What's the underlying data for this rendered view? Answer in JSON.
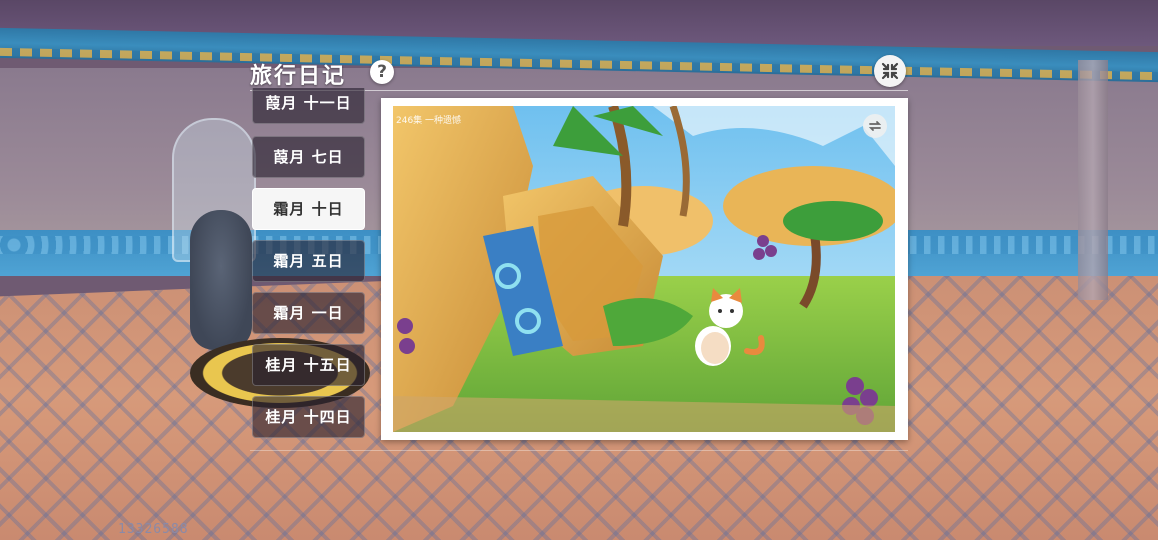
{
  "header": {
    "title": "旅行日记",
    "help_glyph": "?",
    "help_icon": "question-icon",
    "close_icon": "collapse-arrows-icon"
  },
  "tabs": [
    {
      "label": "葭月 十一日",
      "active": false
    },
    {
      "label": "葭月 七日",
      "active": false
    },
    {
      "label": "霜月 十日",
      "active": true
    },
    {
      "label": "霜月 五日",
      "active": false
    },
    {
      "label": "霜月 一日",
      "active": false
    },
    {
      "label": "桂月 十五日",
      "active": false
    },
    {
      "label": "桂月 十四日",
      "active": false
    }
  ],
  "photo": {
    "caption": "246集 一种遗憾",
    "rotate_icon": "rotate-icon",
    "scene": "cat-in-jungle-illustration"
  },
  "hud": {
    "player_id": "13326588"
  },
  "colors": {
    "accent": "#ffffff",
    "tab_bg": "#28202e",
    "tab_active_bg": "#f6f6f6",
    "wall_band": "#3d8fc4"
  }
}
